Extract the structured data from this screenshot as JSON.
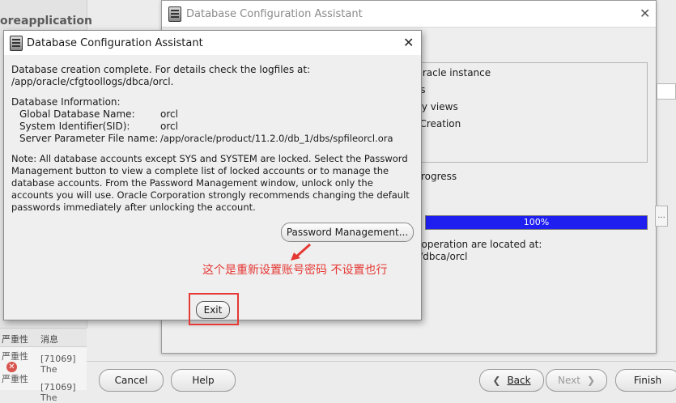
{
  "background_app": {
    "title": "oreapplication",
    "table_headers": [
      "严重性",
      "消息"
    ],
    "rows": [
      {
        "severity": "严重性",
        "message": "[71069] The"
      },
      {
        "severity": "严重性",
        "message": "[71069] The"
      }
    ]
  },
  "main_window": {
    "title": "Database Configuration Assistant",
    "steps": [
      "g Oracle instance",
      "files",
      "nary views",
      "se Creation"
    ],
    "progress_label": "rogress",
    "progress_value": "100%",
    "progress_fraction": 1.0,
    "log_line1": "t operation are located at:",
    "log_line2": "s/dbca/orcl",
    "side_button": "..."
  },
  "bottom_bar": {
    "cancel": "Cancel",
    "help": "Help",
    "back": "Back",
    "next": "Next",
    "finish": "Finish"
  },
  "dialog": {
    "title": "Database Configuration Assistant",
    "complete_line": "Database creation complete. For details check the logfiles at:",
    "log_path": " /app/oracle/cfgtoollogs/dbca/orcl.",
    "info_heading": "Database Information:",
    "info": [
      {
        "label": "Global Database Name:",
        "value": "orcl"
      },
      {
        "label": "System Identifier(SID):",
        "value": "orcl"
      },
      {
        "label": "Server Parameter File name:",
        "value": "/app/oracle/product/11.2.0/db_1/dbs/spfileorcl.ora"
      }
    ],
    "note_lines": [
      "Note: All database accounts except SYS and SYSTEM are locked. Select the Password",
      "Management button to view a complete list of locked accounts or to manage the",
      "database accounts. From the Password Management window, unlock only the",
      "accounts you will use. Oracle Corporation strongly recommends changing the default",
      "passwords immediately after unlocking the account."
    ],
    "password_button": "Password Management...",
    "exit_button": "Exit",
    "annotation": "这个是重新设置账号密码 不设置也行"
  },
  "colors": {
    "progress_fill": "#1f1ff0",
    "annotation_red": "#e53935"
  }
}
